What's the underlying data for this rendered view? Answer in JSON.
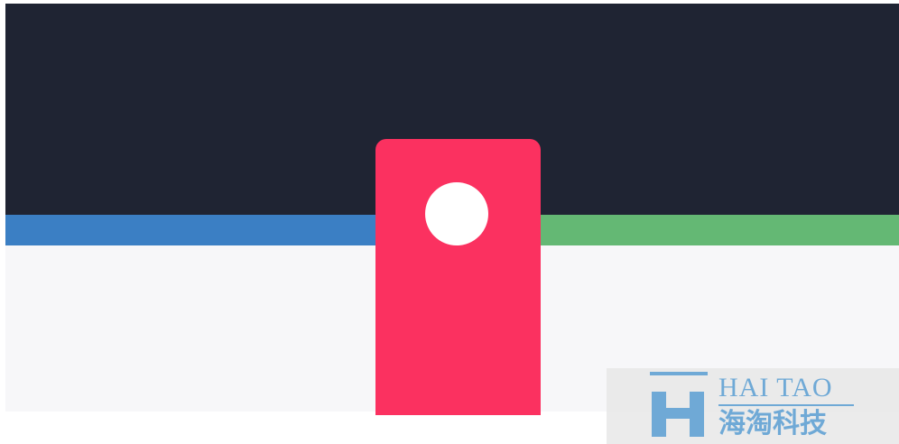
{
  "colors": {
    "top_band": "#1f2433",
    "left_stripe": "#3b7fc4",
    "right_stripe": "#64b874",
    "bottom_band": "#f7f7f9",
    "tag": "#fb3160",
    "tag_hole": "#ffffff",
    "watermark_text": "#6fa9d6"
  },
  "watermark": {
    "logo_icon": "h-letter-logo-icon",
    "brand_en": "HAI TAO",
    "brand_cn": "海淘科技"
  }
}
